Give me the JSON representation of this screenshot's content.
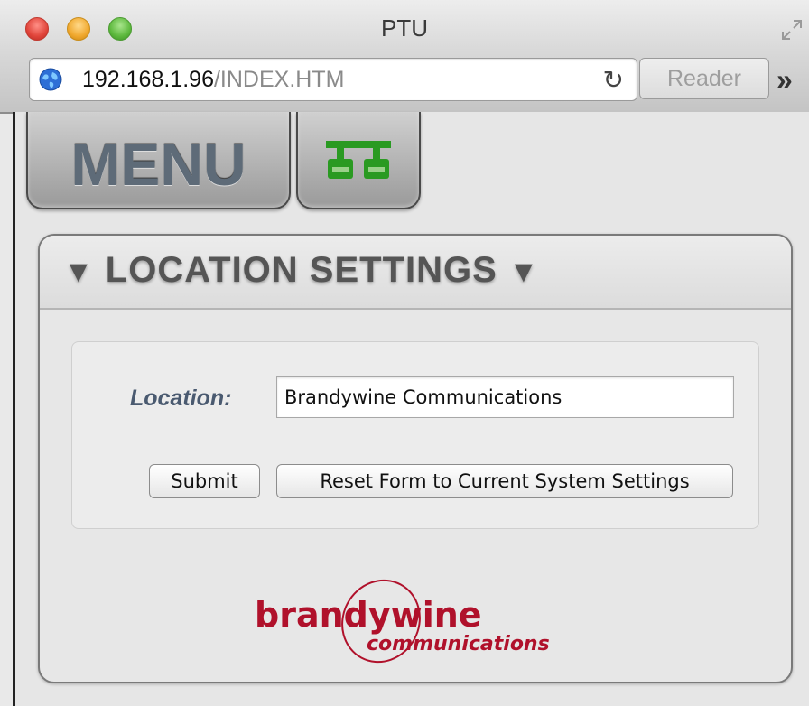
{
  "window": {
    "title": "PTU"
  },
  "toolbar": {
    "url_host": "192.168.1.96",
    "url_path": "/INDEX.HTM",
    "reader_label": "Reader",
    "more_label": "»"
  },
  "nav": {
    "menu_label": "MENU"
  },
  "panel": {
    "title": "LOCATION SETTINGS",
    "location_label": "Location:",
    "location_value": "Brandywine Communications",
    "submit_label": "Submit",
    "reset_label": "Reset Form to Current System Settings"
  },
  "logo": {
    "line1": "brandywine",
    "line2": "communications"
  },
  "colors": {
    "network_icon": "#2a9a22",
    "logo_red": "#b0112b",
    "menu_text": "#5e6b78"
  }
}
